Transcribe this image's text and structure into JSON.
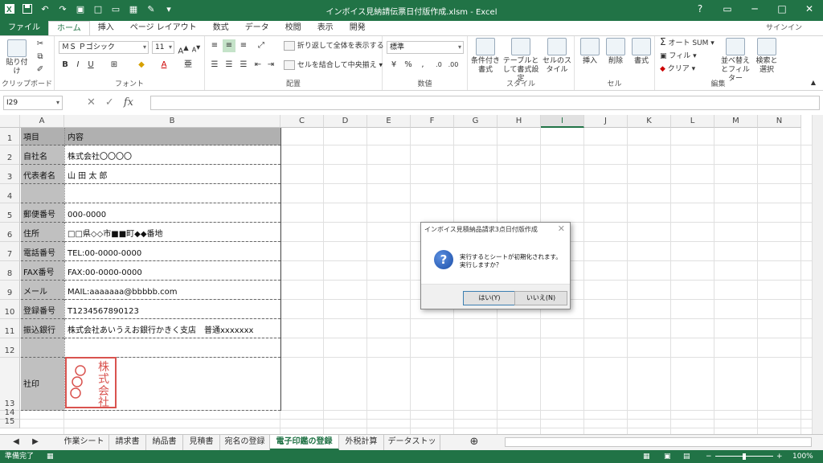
{
  "window": {
    "title": "インボイス見納請伝票日付版作成.xlsm - Excel",
    "user": "サインイン"
  },
  "tabs": [
    {
      "label": "ファイル"
    },
    {
      "label": "ホーム"
    },
    {
      "label": "挿入"
    },
    {
      "label": "ページ レイアウト"
    },
    {
      "label": "数式"
    },
    {
      "label": "データ"
    },
    {
      "label": "校閲"
    },
    {
      "label": "表示"
    },
    {
      "label": "開発"
    }
  ],
  "ribbon": {
    "clipboard": {
      "paste": "貼り付け",
      "group": "クリップボード"
    },
    "font": {
      "name": "ＭＳ Ｐゴシック",
      "size": "11",
      "group": "フォント"
    },
    "alignment": {
      "wrap": "折り返して全体を表示する",
      "merge": "セルを結合して中央揃え",
      "group": "配置"
    },
    "number": {
      "format": "標準",
      "group": "数値"
    },
    "styles": {
      "cond": "条件付き書式",
      "table": "テーブルとして書式設定",
      "cell": "セルのスタイル",
      "group": "スタイル"
    },
    "cells": {
      "insert": "挿入",
      "delete": "削除",
      "format": "書式",
      "group": "セル"
    },
    "editing": {
      "autosum": "オート SUM",
      "fill": "フィル",
      "clear": "クリア",
      "sort": "並べ替えとフィルター",
      "find": "検索と選択",
      "group": "編集"
    }
  },
  "formula_bar": {
    "cell_ref": "I29",
    "fx": "fx",
    "value": ""
  },
  "columns": [
    "A",
    "B",
    "C",
    "D",
    "E",
    "F",
    "G",
    "H",
    "I",
    "J",
    "K",
    "L",
    "M",
    "N"
  ],
  "selected_column": "I",
  "rows": [
    {
      "num": "1",
      "a": "項目",
      "b": "内容"
    },
    {
      "num": "2",
      "a": "自社名",
      "b": "株式会社〇〇〇〇"
    },
    {
      "num": "3",
      "a": "代表者名",
      "b": "山 田 太 郎"
    },
    {
      "num": "4",
      "a": "",
      "b": ""
    },
    {
      "num": "5",
      "a": "郵便番号",
      "b": "000-0000"
    },
    {
      "num": "6",
      "a": "住所",
      "b": "□□県◇◇市■■町◆◆番地"
    },
    {
      "num": "7",
      "a": "電話番号",
      "b": "TEL:00-0000-0000"
    },
    {
      "num": "8",
      "a": "FAX番号",
      "b": "FAX:00-0000-0000"
    },
    {
      "num": "9",
      "a": "メール",
      "b": "MAIL:aaaaaaa@bbbbb.com"
    },
    {
      "num": "10",
      "a": "登録番号",
      "b": "T1234567890123"
    },
    {
      "num": "11",
      "a": "振込銀行",
      "b": "株式会社あいうえお銀行かきく支店　普通xxxxxxx"
    },
    {
      "num": "12",
      "a": "",
      "b": ""
    },
    {
      "num": "13",
      "a": "社印",
      "b": ""
    },
    {
      "num": "14",
      "a": "",
      "b": ""
    },
    {
      "num": "15",
      "a": "",
      "b": ""
    }
  ],
  "seal": {
    "text": "株式会社",
    "color": "#d9534f"
  },
  "sheets": [
    {
      "label": "作業シート"
    },
    {
      "label": "請求書"
    },
    {
      "label": "納品書"
    },
    {
      "label": "見積書"
    },
    {
      "label": "宛名の登録"
    },
    {
      "label": "電子印鑑の登録"
    },
    {
      "label": "外税計算"
    },
    {
      "label": "データストック"
    }
  ],
  "active_sheet": "電子印鑑の登録",
  "status": {
    "ready": "準備完了",
    "zoom": "100%"
  },
  "dialog": {
    "title": "インボイス見積納品請求3点日付版作成",
    "line1": "実行するとシートが初期化されます。",
    "line2": "実行しますか？",
    "yes": "はい(Y)",
    "no": "いいえ(N)"
  },
  "colors": {
    "excel_green": "#217346",
    "header_gray": "#c0c0c0"
  }
}
